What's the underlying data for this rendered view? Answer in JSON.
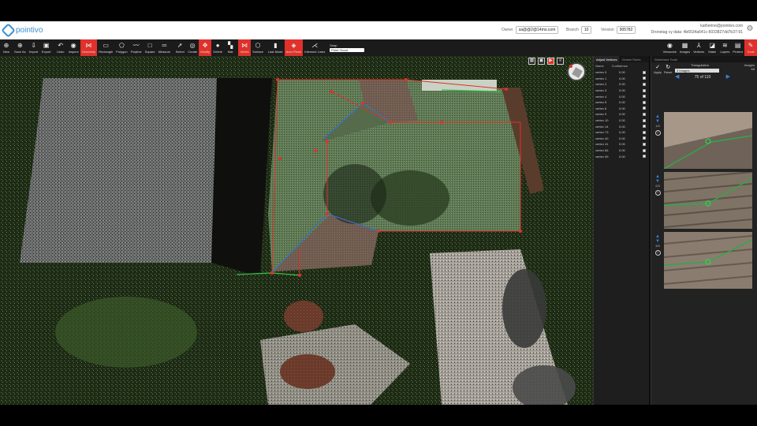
{
  "app": {
    "logo_text": "pointivo"
  },
  "header": {
    "owner_label": "Owner",
    "owner_value": "sa@@2@14mo.com",
    "branch_label": "Branch",
    "branch_value": "10",
    "version_label": "Version",
    "version_value": "905782",
    "user_email": "katherine@pointivo.com",
    "dataset_id": "Dronetag cy data: 4b6534a641c-6033827dd7b37-91"
  },
  "toolbar": {
    "items": [
      {
        "label": "New",
        "icon": "new-icon"
      },
      {
        "label": "Save As",
        "icon": "save-as-icon"
      },
      {
        "label": "Import",
        "icon": "import-icon"
      },
      {
        "label": "Export",
        "icon": "export-icon"
      },
      {
        "label": "Undo",
        "icon": "undo-icon"
      },
      {
        "label": "Inspect",
        "icon": "inspect-icon"
      },
      {
        "label": "Geometry",
        "icon": "geometry-icon",
        "active": true
      },
      {
        "label": "Rectangle",
        "icon": "rectangle-icon"
      },
      {
        "label": "Polygon",
        "icon": "polygon-icon"
      },
      {
        "label": "Polyline",
        "icon": "polyline-icon"
      },
      {
        "label": "Square",
        "icon": "square-icon"
      },
      {
        "label": "Measure",
        "icon": "measure-icon"
      },
      {
        "label": "Select",
        "icon": "select-icon"
      },
      {
        "label": "Create",
        "icon": "create-icon"
      },
      {
        "label": "Modify",
        "icon": "modify-icon",
        "active": true
      },
      {
        "label": "Delete",
        "icon": "delete-icon"
      },
      {
        "label": "Mat",
        "icon": "mat-icon"
      },
      {
        "label": "Vertex",
        "icon": "vertex-icon",
        "active": true
      },
      {
        "label": "Surface",
        "icon": "surface-icon"
      },
      {
        "label": "Last Mode",
        "icon": "last-mode-icon"
      },
      {
        "label": "Auto Plane",
        "icon": "auto-plane-icon",
        "active": true
      },
      {
        "label": "Intersect Lines",
        "icon": "intersect-lines-icon"
      }
    ],
    "snap_label": "Snap",
    "snap_value": "Point Cloud",
    "right_items": [
      {
        "label": "Viewcube",
        "icon": "viewcube-icon"
      },
      {
        "label": "Images",
        "icon": "images-icon"
      },
      {
        "label": "Vertices",
        "icon": "vertices-icon"
      },
      {
        "label": "Make",
        "icon": "make-icon"
      },
      {
        "label": "Layers",
        "icon": "layers-icon"
      },
      {
        "label": "Protect",
        "icon": "protect-icon"
      },
      {
        "label": "Tools",
        "icon": "tools-icon",
        "active": true
      }
    ]
  },
  "vertex_panel": {
    "tabs": [
      "Adjust Vertices",
      "Cluster Rules",
      "Wireframe Tools"
    ],
    "col_name": "Name",
    "col_conf": "Confidence",
    "rows": [
      {
        "name": "vertex 0",
        "conf": "0.00"
      },
      {
        "name": "vertex 1",
        "conf": "0.00"
      },
      {
        "name": "vertex 2",
        "conf": "0.00"
      },
      {
        "name": "vertex 3",
        "conf": "0.00"
      },
      {
        "name": "vertex 4",
        "conf": "0.00"
      },
      {
        "name": "vertex 5",
        "conf": "0.00"
      },
      {
        "name": "vertex 6",
        "conf": "0.00"
      },
      {
        "name": "vertex 9",
        "conf": "0.00"
      },
      {
        "name": "vertex 10",
        "conf": "0.00"
      },
      {
        "name": "vertex 14",
        "conf": "0.00"
      },
      {
        "name": "vertex 73",
        "conf": "0.00"
      },
      {
        "name": "vertex 40",
        "conf": "0.00"
      },
      {
        "name": "vertex 41",
        "conf": "0.00"
      },
      {
        "name": "vertex 66",
        "conf": "0.00"
      },
      {
        "name": "vertex 99",
        "conf": "0.00"
      }
    ]
  },
  "image_panel": {
    "apply_label": "Apply",
    "reset_label": "Reset",
    "triangulation_label": "Triangulation",
    "images_select": "3 Images",
    "count_label": "Images",
    "count_value": "65",
    "pager_text": "75 of 110",
    "thumbs": [
      {
        "index": "1/3"
      },
      {
        "index": "2/3"
      },
      {
        "index": "3/3"
      }
    ]
  },
  "colors": {
    "accent": "#e0312b",
    "toolbar_bg": "#1b1b1b",
    "roof_green": "#5f7a55"
  }
}
